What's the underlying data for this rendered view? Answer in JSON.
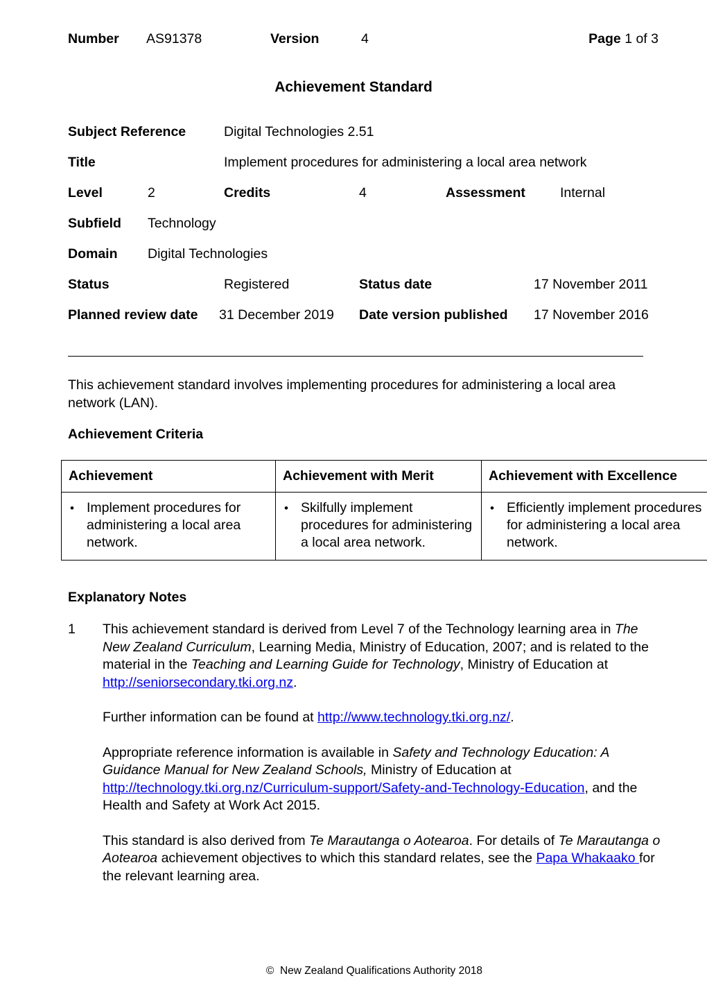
{
  "header": {
    "number_label": "Number",
    "number_value": "AS91378",
    "version_label": "Version",
    "version_value": "4",
    "page_label": "Page",
    "page_value": "1 of 3"
  },
  "title": "Achievement Standard",
  "meta": {
    "subject_reference_label": "Subject Reference",
    "subject_reference_value": "Digital Technologies 2.51",
    "title_label": "Title",
    "title_value": "Implement procedures for administering a local area network",
    "level_label": "Level",
    "level_value": "2",
    "credits_label": "Credits",
    "credits_value": "4",
    "assessment_label": "Assessment",
    "assessment_value": "Internal",
    "subfield_label": "Subfield",
    "subfield_value": "Technology",
    "domain_label": "Domain",
    "domain_value": "Digital Technologies",
    "status_label": "Status",
    "status_value": "Registered",
    "status_date_label": "Status date",
    "status_date_value": "17 November 2011",
    "planned_review_label": "Planned review date",
    "planned_review_value": "31 December 2019",
    "date_published_label": "Date version published",
    "date_published_value": "17 November 2016"
  },
  "intro": "This achievement standard involves implementing procedures for administering a local area network (LAN).",
  "achievement_criteria": {
    "heading": "Achievement Criteria",
    "columns": [
      "Achievement",
      "Achievement with Merit",
      "Achievement with Excellence"
    ],
    "rows": [
      [
        "Implement procedures for administering a local area network.",
        "Skilfully implement procedures for administering a local area network.",
        "Efficiently implement procedures for administering a local area network."
      ]
    ]
  },
  "explanatory_notes": {
    "heading": "Explanatory Notes",
    "note1": {
      "number": "1",
      "seg1": "This achievement standard is derived from Level 7 of the Technology learning area in ",
      "italic1": "The New Zealand Curriculum",
      "seg2": ", Learning Media, Ministry of Education, 2007; and is related to the material in the ",
      "italic2": "Teaching and Learning Guide for Technology",
      "seg3": ", Ministry of Education at ",
      "link1": "http://seniorsecondary.tki.org.nz",
      "seg4": "."
    },
    "para2": {
      "seg1": "Further information can be found at ",
      "link1": "http://www.technology.tki.org.nz/",
      "seg2": "."
    },
    "para3": {
      "seg1": "Appropriate reference information is available in ",
      "italic1": "Safety and Technology Education: A Guidance Manual for New Zealand Schools,",
      "seg2": " Ministry of Education at ",
      "link1": "http://technology.tki.org.nz/Curriculum-support/Safety-and-Technology-Education",
      "seg3": ", and the Health and Safety at Work Act 2015."
    },
    "para4": {
      "seg1": "This standard is also derived from ",
      "italic1": "Te Marautanga o Aotearoa",
      "seg2": ".  For details of ",
      "italic2": "Te Marautanga o Aotearoa",
      "seg3": " achievement objectives to which this standard relates, see the ",
      "link1": "Papa Whakaako ",
      "seg4": "for the relevant learning area."
    }
  },
  "footer": {
    "copyright_symbol": "©",
    "text": "New Zealand Qualifications Authority 2018"
  }
}
